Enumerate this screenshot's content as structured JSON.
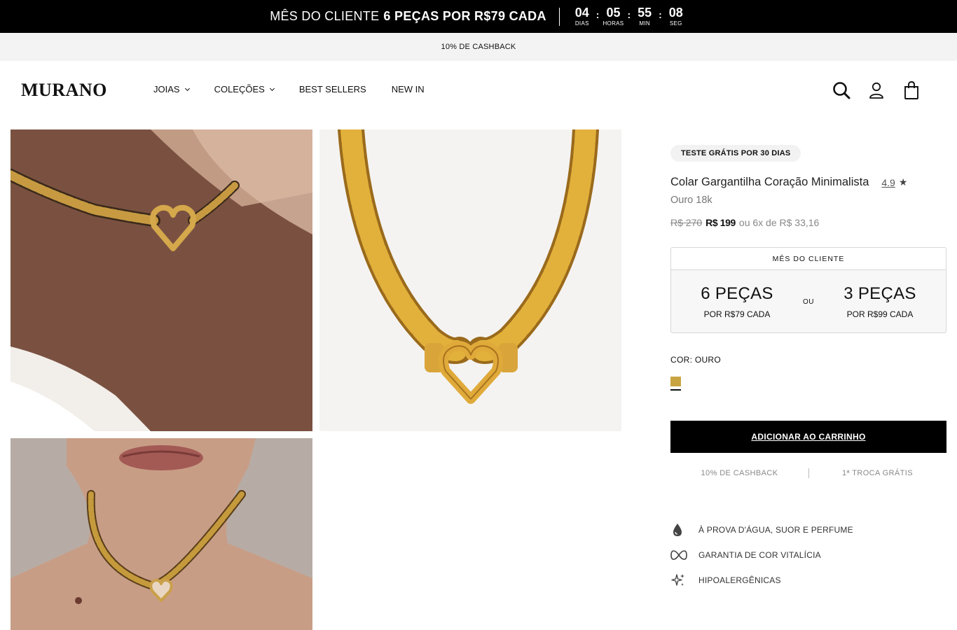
{
  "announcement": {
    "lead": "MÊS DO CLIENTE",
    "highlight": "6 PEÇAS POR R$79 CADA",
    "countdown": [
      {
        "value": "04",
        "label": "DIAS"
      },
      {
        "value": "05",
        "label": "HORAS"
      },
      {
        "value": "55",
        "label": "MIN"
      },
      {
        "value": "08",
        "label": "SEG"
      }
    ],
    "separator": ":"
  },
  "cashback_bar": {
    "text": "10% DE CASHBACK"
  },
  "header": {
    "logo": "MURANO",
    "nav": [
      {
        "label": "JOIAS",
        "dropdown": true
      },
      {
        "label": "COLEÇÕES",
        "dropdown": true
      },
      {
        "label": "BEST SELLERS",
        "dropdown": false
      },
      {
        "label": "NEW IN",
        "dropdown": false
      }
    ],
    "icons": [
      "search-icon",
      "account-icon",
      "bag-icon"
    ]
  },
  "gallery": {
    "images": [
      "necklace-on-neck-closeup",
      "necklace-product-shot",
      "necklace-on-model"
    ]
  },
  "product": {
    "badge": "TESTE GRÁTIS POR 30 DIAS",
    "title": "Colar Gargantilha Coração Minimalista",
    "rating": "4.9",
    "star": "★",
    "subtitle": "Ouro 18k",
    "old_price": "R$ 270",
    "price": "R$ 199",
    "installments": "ou 6x de R$ 33,16"
  },
  "promo_box": {
    "heading": "MÊS DO CLIENTE",
    "offers": [
      {
        "qty": "6 PEÇAS",
        "price": "POR R$79 CADA"
      },
      {
        "qty": "3 PEÇAS",
        "price": "POR R$99 CADA"
      }
    ],
    "or": "OU"
  },
  "color": {
    "label": "COR: OURO",
    "swatch_color": "#c9a443"
  },
  "cart": {
    "button": "ADICIONAR AO CARRINHO"
  },
  "perks": [
    "10% DE CASHBACK",
    "1ª TROCA GRÁTIS"
  ],
  "features": [
    {
      "icon": "water-drop-icon",
      "text": "À PROVA D'ÁGUA, SUOR E PERFUME"
    },
    {
      "icon": "infinity-icon",
      "text": "GARANTIA DE COR VITALÍCIA"
    },
    {
      "icon": "sparkles-icon",
      "text": "HIPOALERGÊNICAS"
    }
  ],
  "colors": {
    "accent_black": "#000000",
    "gold": "#c9a443",
    "muted": "#888888"
  }
}
